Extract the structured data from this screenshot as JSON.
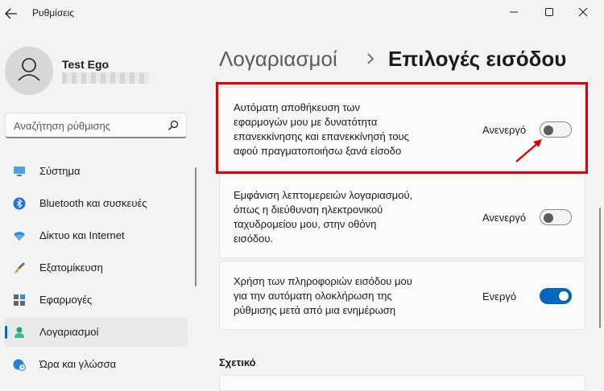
{
  "window": {
    "title": "Ρυθμίσεις",
    "controls": [
      "minimize-icon",
      "maximize-icon",
      "close-icon"
    ]
  },
  "profile": {
    "name": "Test Ego"
  },
  "search": {
    "placeholder": "Αναζήτηση ρύθμισης"
  },
  "sidebar": {
    "items": [
      {
        "label": "Σύστημα",
        "icon": "monitor-icon",
        "selected": false
      },
      {
        "label": "Bluetooth και συσκευές",
        "icon": "bluetooth-icon",
        "selected": false
      },
      {
        "label": "Δίκτυο και Internet",
        "icon": "wifi-icon",
        "selected": false
      },
      {
        "label": "Εξατομίκευση",
        "icon": "paintbrush-icon",
        "selected": false
      },
      {
        "label": "Εφαρμογές",
        "icon": "apps-icon",
        "selected": false
      },
      {
        "label": "Λογαριασμοί",
        "icon": "person-icon",
        "selected": true
      },
      {
        "label": "Ώρα και γλώσσα",
        "icon": "clock-globe-icon",
        "selected": false
      }
    ]
  },
  "breadcrumb": {
    "parent": "Λογαριασμοί",
    "separator": "›",
    "current": "Επιλογές εισόδου"
  },
  "settings": [
    {
      "lines": [
        "Αυτόματη αποθήκευση των",
        "εφαρμογών μου με δυνατότητα",
        "επανεκκίνησης και επανεκκίνησή τους",
        "αφού πραγματοποιήσω ξανά είσοδο"
      ],
      "state": "Ανενεργό",
      "on": false
    },
    {
      "lines": [
        "Εμφάνιση λεπτομερειών λογαριασμού,",
        "όπως η διεύθυνση ηλεκτρονικού",
        "ταχυδρομείου μου, στην οθόνη",
        "εισόδου."
      ],
      "state": "Ανενεργό",
      "on": false
    },
    {
      "lines": [
        "Χρήση των πληροφοριών εισόδου μου",
        "για την αυτόματη ολοκλήρωση της",
        "ρύθμισης μετά από μια ενημέρωση"
      ],
      "state": "Ενεργό",
      "on": true
    }
  ],
  "related": {
    "title": "Σχετικό"
  },
  "colors": {
    "accent": "#0067c0",
    "highlight": "#e00000",
    "background": "#f3f3f3",
    "card": "#fbfbfb"
  }
}
